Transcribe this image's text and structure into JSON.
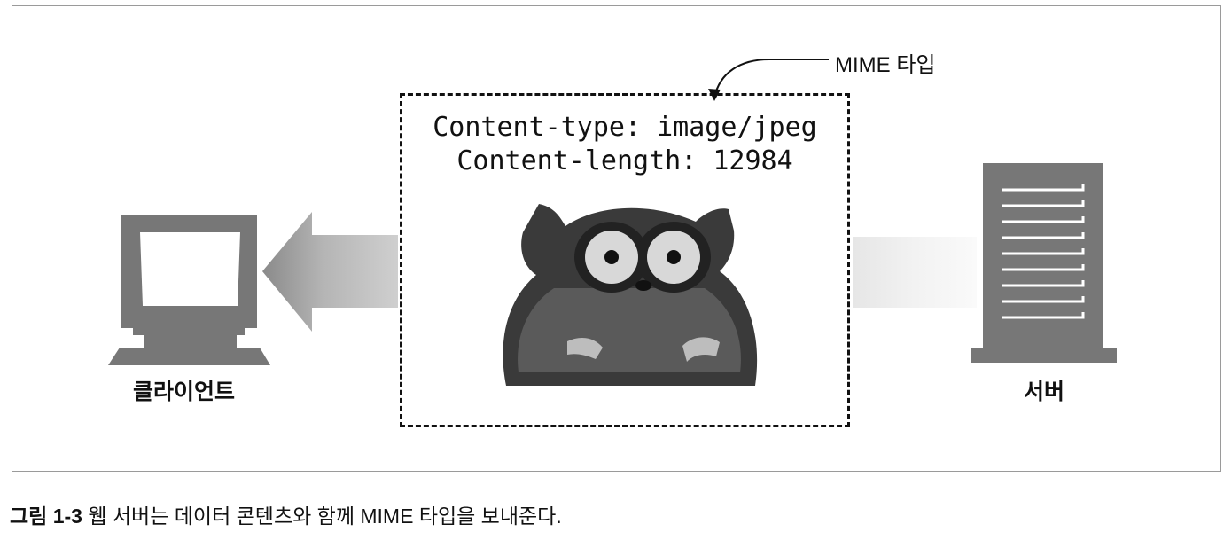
{
  "diagram": {
    "payload": {
      "content_type_line": "Content-type: image/jpeg",
      "content_length_line": "Content-length: 12984"
    },
    "annotation": "MIME 타입",
    "client_label": "클라이언트",
    "server_label": "서버",
    "icons": [
      "computer-monitor-icon",
      "server-tower-icon",
      "tarsier-image",
      "left-arrow-icon"
    ],
    "colors": {
      "icon_gray": "#777777",
      "arrow_dark": "#8a8a8a",
      "arrow_light": "#cfcfcf"
    }
  },
  "caption": {
    "figure_number": "그림 1-3",
    "text": " 웹 서버는 데이터 콘텐츠와 함께 MIME 타입을 보내준다."
  }
}
